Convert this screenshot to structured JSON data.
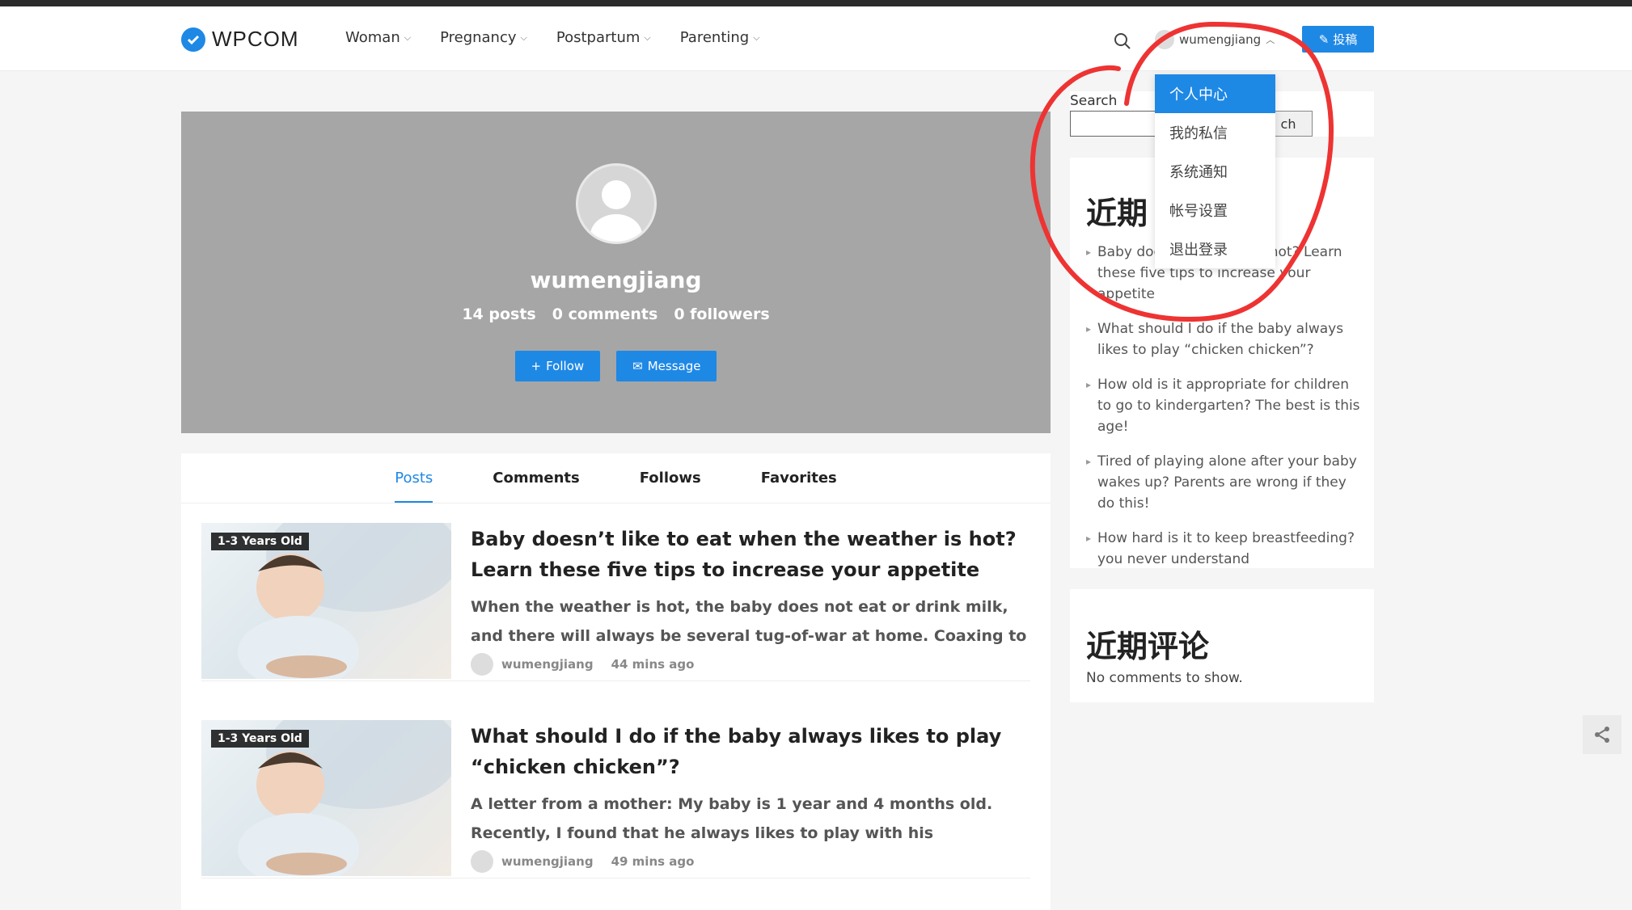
{
  "header": {
    "logo_text": "WPCOM",
    "nav": [
      "Woman",
      "Pregnancy",
      "Postpartum",
      "Parenting"
    ],
    "username": "wumengjiang",
    "contribute_label": "投稿"
  },
  "user_dropdown": {
    "items": [
      "个人中心",
      "我的私信",
      "系统通知",
      "帐号设置",
      "退出登录"
    ],
    "active_index": 0
  },
  "profile": {
    "name": "wumengjiang",
    "stats": [
      "14 posts",
      "0 comments",
      "0 followers"
    ],
    "follow_label": "Follow",
    "message_label": "Message"
  },
  "tabs": [
    "Posts",
    "Comments",
    "Follows",
    "Favorites"
  ],
  "posts": [
    {
      "badge": "1-3 Years Old",
      "title": "Baby doesn’t like to eat when the weather is hot? Learn these five tips to increase your appetite",
      "excerpt": "When the weather is hot, the baby does not eat or drink milk, and there will always be several tug-of-war at home. Coaxing to feed,...",
      "author": "wumengjiang",
      "time": "44 mins ago"
    },
    {
      "badge": "1-3 Years Old",
      "title": "What should I do if the baby always likes to play “chicken chicken”?",
      "excerpt": "A letter from a mother: My baby is 1 year and 4 months old. Recently, I found that he always likes to play with his “chicken”. May I ask ho...",
      "author": "wumengjiang",
      "time": "49 mins ago"
    }
  ],
  "sidebar": {
    "search_label": "Search",
    "search_button": "ch",
    "recent_posts_title": "近期",
    "recent_posts": [
      "Baby doe                       the weather is hot? Learn these five tips to increase your appetite",
      "What should I do if the baby always likes to play “chicken chicken”?",
      "How old is it appropriate for children to go to kindergarten? The best is this age!",
      "Tired of playing alone after your baby wakes up? Parents are wrong if they do this!",
      "How hard is it to keep breastfeeding? you never understand"
    ],
    "recent_comments_title": "近期评论",
    "no_comments": "No comments to show."
  },
  "colors": {
    "accent": "#1e88e5",
    "cover": "#a6a6a6",
    "annotation": "#ee3333"
  }
}
